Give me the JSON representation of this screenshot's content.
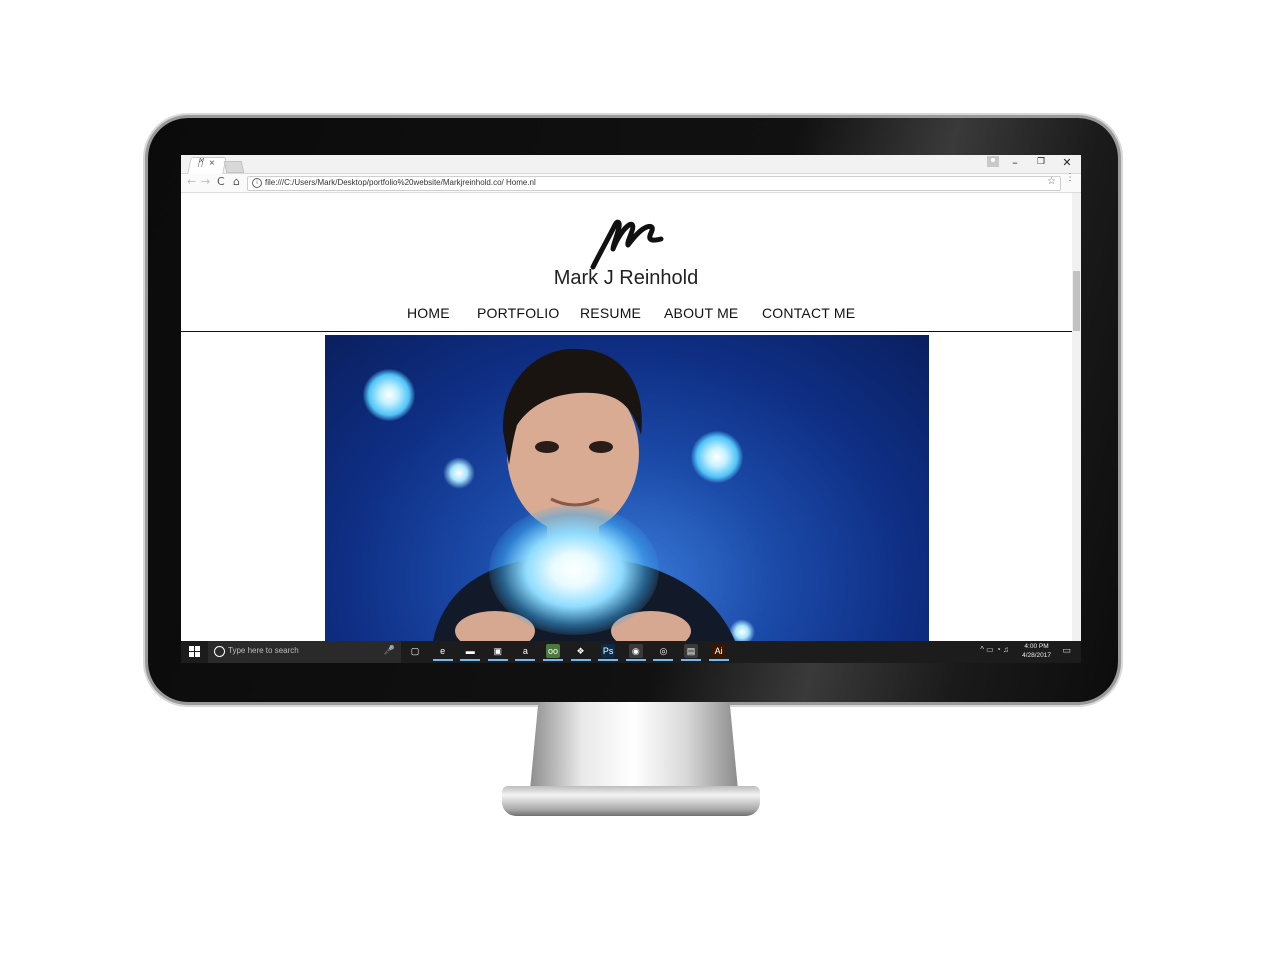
{
  "browser": {
    "tab_favicon": "ᛗ",
    "tab_close": "×",
    "window_minimize": "–",
    "window_restore": "❐",
    "window_close": "✕",
    "nav_back": "←",
    "nav_forward": "→",
    "nav_reload": "C",
    "nav_home": "⌂",
    "info": "i",
    "url": "file:///C:/Users/Mark/Desktop/portfolio%20website/Markjreinhold.co/ Home.nl",
    "bookmark": "☆",
    "menu": "⋮"
  },
  "site": {
    "title": "Mark J Reinhold",
    "nav": [
      "HOME",
      "PORTFOLIO",
      "RESUME",
      "ABOUT ME",
      "CONTACT ME"
    ]
  },
  "taskbar": {
    "search_placeholder": "Type here to search",
    "mic": "🎤",
    "apps": [
      {
        "icon": "task-view-icon",
        "glyph": "▢",
        "color": "#1c1c1c"
      },
      {
        "icon": "edge-icon",
        "glyph": "e",
        "color": "#1c1c1c"
      },
      {
        "icon": "file-explorer-icon",
        "glyph": "▬",
        "color": "#1c1c1c"
      },
      {
        "icon": "store-icon",
        "glyph": "▣",
        "color": "#1c1c1c"
      },
      {
        "icon": "amazon-icon",
        "glyph": "a",
        "color": "#1c1c1c"
      },
      {
        "icon": "tripadvisor-icon",
        "glyph": "oo",
        "color": "#4a7a3c"
      },
      {
        "icon": "dropbox-icon",
        "glyph": "❖",
        "color": "#1c1c1c"
      },
      {
        "icon": "photoshop-icon",
        "glyph": "Ps",
        "color": "#0b2a47"
      },
      {
        "icon": "chrome-icon",
        "glyph": "◉",
        "color": "#3a3a3a"
      },
      {
        "icon": "media-app-icon",
        "glyph": "◎",
        "color": "#1c1c1c"
      },
      {
        "icon": "video-app-icon",
        "glyph": "▤",
        "color": "#3a3a3a"
      },
      {
        "icon": "illustrator-icon",
        "glyph": "Ai",
        "color": "#3a1600"
      }
    ],
    "tray": "^ ▭ ◔ ♫",
    "time": "4:00 PM",
    "date": "4/28/2017",
    "notifications": "▭"
  }
}
